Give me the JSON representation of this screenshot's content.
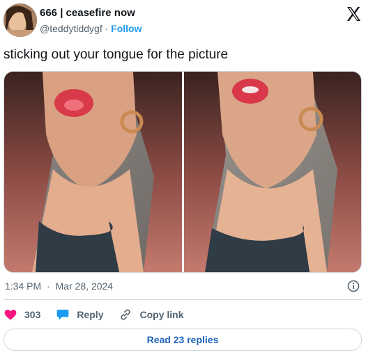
{
  "author": {
    "display_name": "666 | ceasefire now",
    "handle": "@teddytiddygf",
    "separator": "·",
    "follow_label": "Follow"
  },
  "tweet": {
    "text": "sticking out your tongue for the picture",
    "time": "1:34 PM",
    "date": "Mar 28, 2024",
    "dot": "·"
  },
  "actions": {
    "like_count": "303",
    "reply_label": "Reply",
    "copy_link_label": "Copy link"
  },
  "read_replies_label": "Read 23 replies",
  "colors": {
    "accent": "#1d9bf0",
    "like": "#f91880",
    "text_secondary": "#536471"
  },
  "icons": [
    "x-logo-icon",
    "info-icon",
    "heart-icon",
    "reply-bubble-icon",
    "link-icon"
  ]
}
